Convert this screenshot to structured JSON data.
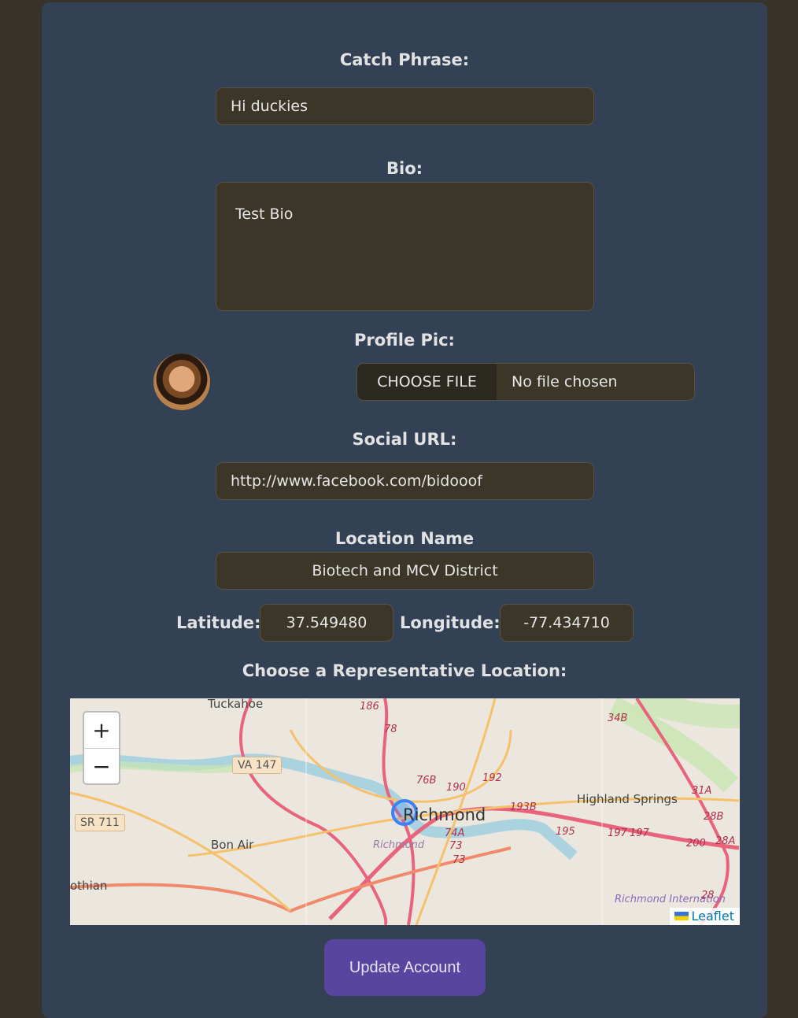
{
  "form": {
    "catch_phrase_label": "Catch Phrase:",
    "catch_phrase_value": "Hi duckies",
    "bio_label": "Bio:",
    "bio_value": "Test Bio",
    "profile_pic_label": "Profile Pic:",
    "choose_file_label": "CHOOSE FILE",
    "no_file_text": "No file chosen",
    "social_url_label": "Social URL:",
    "social_url_value": "http://www.facebook.com/bidooof",
    "location_name_label": "Location Name",
    "location_name_value": "Biotech and MCV District",
    "latitude_label": "Latitude:",
    "latitude_value": "37.549480",
    "longitude_label": "Longitude:",
    "longitude_value": "-77.434710",
    "map_label": "Choose a Representative Location:",
    "submit_label": "Update Account"
  },
  "map": {
    "zoom_in": "+",
    "zoom_out": "−",
    "attribution": "Leaflet",
    "places": [
      "Tuckahoe",
      "Richmond",
      "Highland Springs",
      "Bon Air",
      "othian",
      "Richmond",
      "Richmond Internation"
    ],
    "shields": [
      "VA 147",
      "SR 711"
    ],
    "route_numbers": [
      "186",
      "78",
      "76B",
      "190",
      "192",
      "193B",
      "74A",
      "73",
      "73",
      "195",
      "197",
      "197",
      "34B",
      "31A",
      "28B",
      "200",
      "28A",
      "28"
    ],
    "colors": {
      "marker": "#3b82f6",
      "roads_major": "#e8637c",
      "roads_minor": "#f5c16b",
      "water": "#aad3df",
      "park": "#c8e6b0"
    }
  },
  "colors": {
    "card": "#334155",
    "page": "#37332a",
    "input": "#3c3629",
    "button": "#5845a0"
  }
}
